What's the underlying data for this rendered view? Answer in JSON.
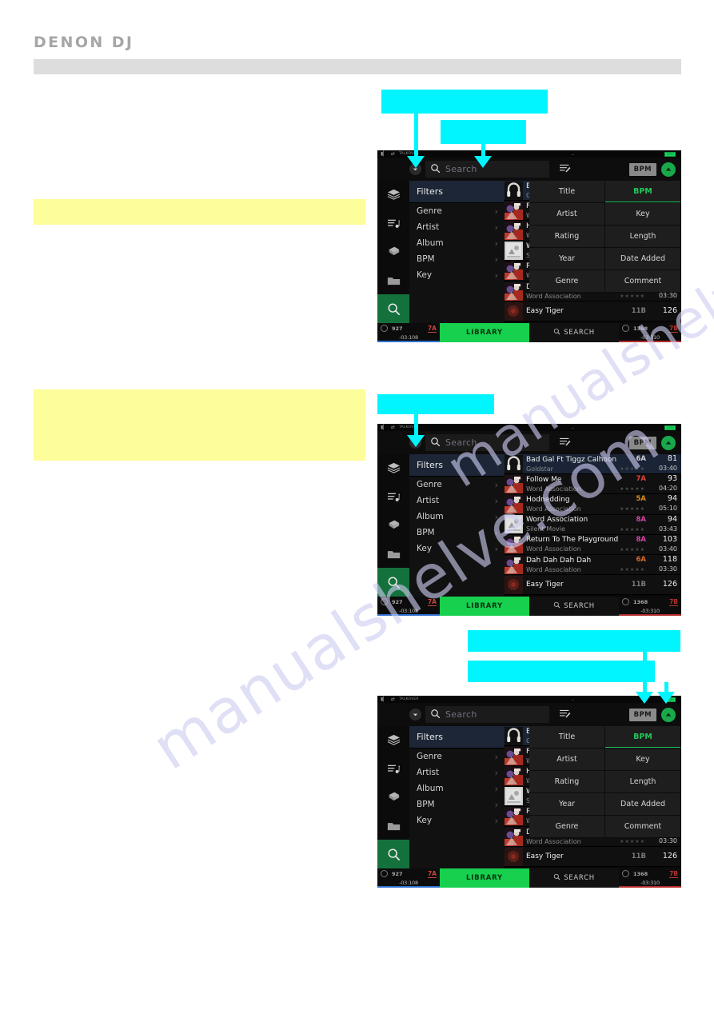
{
  "page": {
    "brand": "DENON DJ",
    "watermark": "manualshelve.com"
  },
  "device": {
    "statusbar": {
      "talkover": "TALKOVER",
      "battery": "100%"
    },
    "toolbar": {
      "search_placeholder": "Search",
      "bpm_button": "BPM",
      "dropdown_icon": "chevron-down-icon",
      "search_icon": "search-icon",
      "list_icon": "list-edit-icon",
      "sort_direction_icon": "arrow-up-icon"
    },
    "rail": [
      {
        "name": "collection",
        "icon": "stack-icon"
      },
      {
        "name": "playlists",
        "icon": "playlist-icon"
      },
      {
        "name": "crates",
        "icon": "crate-icon"
      },
      {
        "name": "files",
        "icon": "folder-icon"
      },
      {
        "name": "search",
        "icon": "search-icon",
        "active": true
      }
    ],
    "filters": {
      "title": "Filters",
      "items": [
        {
          "label": "Genre"
        },
        {
          "label": "Artist"
        },
        {
          "label": "Album"
        },
        {
          "label": "BPM"
        },
        {
          "label": "Key"
        }
      ]
    },
    "sort_menu": {
      "active": "BPM",
      "cells": [
        "Title",
        "BPM",
        "Artist",
        "Key",
        "Rating",
        "Length",
        "Year",
        "Date Added",
        "Genre",
        "Comment"
      ]
    },
    "tracks": [
      {
        "title": "Bad Gal Ft Tiggz Calhoon",
        "artist": "Goldstar",
        "key": "6A",
        "key_color": "#cfcfcf",
        "bpm": "81",
        "length": "03:40",
        "rating": "★★★★★",
        "selected": true,
        "art": "headphones"
      },
      {
        "title": "Follow Me",
        "artist": "Word Association",
        "key": "7A",
        "key_color": "#e0443a",
        "bpm": "93",
        "length": "04:20",
        "rating": "★★★★★",
        "selected": false,
        "art": "red"
      },
      {
        "title": "Hodnedding",
        "artist": "Word Association",
        "key": "5A",
        "key_color": "#d98a22",
        "bpm": "94",
        "length": "05:10",
        "rating": "★★★★★",
        "selected": false,
        "art": "red"
      },
      {
        "title": "Word Association",
        "artist": "Silent Movie",
        "key": "8A",
        "key_color": "#d246a8",
        "bpm": "94",
        "length": "03:43",
        "rating": "★★★★★",
        "selected": false,
        "art": "gray"
      },
      {
        "title": "Return To The Playground",
        "artist": "Word Association",
        "key": "8A",
        "key_color": "#d246a8",
        "bpm": "103",
        "length": "03:40",
        "rating": "★★★★★",
        "selected": false,
        "art": "red"
      },
      {
        "title": "Dah Dah Dah Dah",
        "artist": "Word Association",
        "key": "6A",
        "key_color": "#d96a22",
        "bpm": "118",
        "length": "03:30",
        "rating": "★★★★★",
        "selected": false,
        "art": "red"
      },
      {
        "title": "Easy Tiger",
        "artist": "",
        "key": "11B",
        "key_color": "#7a7a7a",
        "bpm": "126",
        "length": "",
        "rating": "",
        "selected": false,
        "art": "dark"
      }
    ],
    "deckbar": {
      "deck_left": {
        "bpm": "92",
        "bpm_dec": "7",
        "key": "7A",
        "key_color": "#c8463c",
        "time": "-03:10",
        "time_dec": "8",
        "underline": "#2f6fd0"
      },
      "deck_right": {
        "bpm": "136",
        "bpm_dec": "8",
        "key": "7B",
        "key_color": "#b0362e",
        "time": "-03:31",
        "time_dec": "0",
        "underline": "#b42b2b"
      },
      "library_label": "LIBRARY",
      "search_label": "SEARCH"
    }
  }
}
